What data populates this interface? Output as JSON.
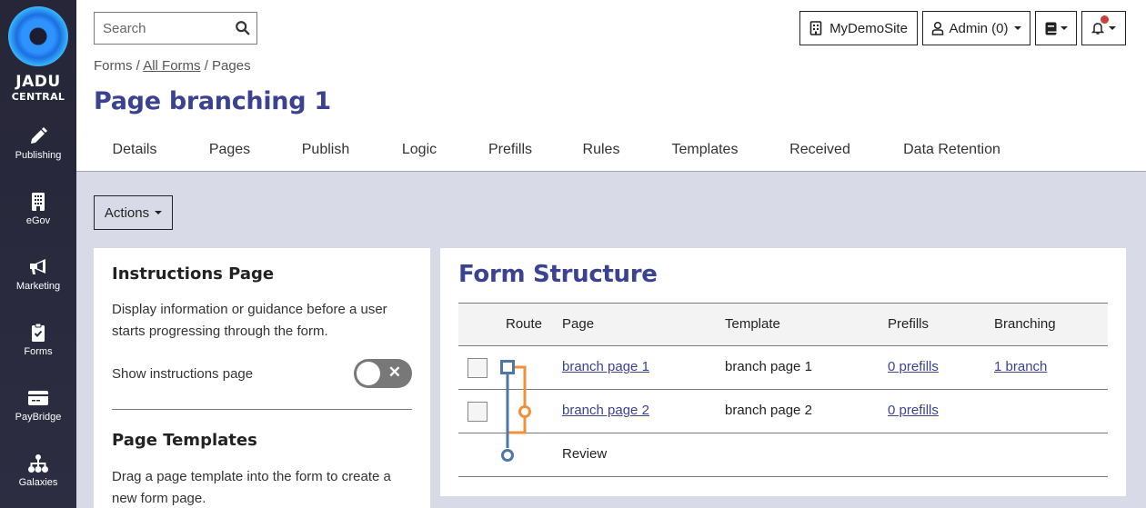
{
  "sidebar": {
    "logo": {
      "line1": "JADU",
      "line2": "CENTRAL"
    },
    "items": [
      {
        "label": "Publishing",
        "icon": "pencil-icon"
      },
      {
        "label": "eGov",
        "icon": "building-icon"
      },
      {
        "label": "Marketing",
        "icon": "megaphone-icon"
      },
      {
        "label": "Forms",
        "icon": "clipboard-check-icon"
      },
      {
        "label": "PayBridge",
        "icon": "credit-card-icon"
      },
      {
        "label": "Galaxies",
        "icon": "sitemap-icon"
      }
    ]
  },
  "header": {
    "search": {
      "placeholder": "Search",
      "value": ""
    },
    "site_button": "MyDemoSite",
    "user_button": "Admin (0)",
    "breadcrumb": [
      {
        "label": "Forms",
        "link": false
      },
      {
        "label": "All Forms",
        "link": true
      },
      {
        "label": "Pages",
        "link": false
      }
    ],
    "breadcrumb_separator": "/",
    "title": "Page branching 1",
    "tabs": [
      {
        "label": "Details",
        "active": false
      },
      {
        "label": "Pages",
        "active": true
      },
      {
        "label": "Publish",
        "active": false
      },
      {
        "label": "Logic",
        "active": false
      },
      {
        "label": "Prefills",
        "active": false
      },
      {
        "label": "Rules",
        "active": false
      },
      {
        "label": "Templates",
        "active": false
      },
      {
        "label": "Received",
        "active": false
      },
      {
        "label": "Data Retention",
        "active": false
      }
    ]
  },
  "actions_label": "Actions",
  "instructions": {
    "title": "Instructions Page",
    "description": "Display information or guidance before a user starts progressing through the form.",
    "toggle_label": "Show instructions page",
    "toggle_on": false,
    "toggle_off_glyph": "✕"
  },
  "templates": {
    "title": "Page Templates",
    "description": "Drag a page template into the form to create a new form page."
  },
  "form_structure": {
    "title": "Form Structure",
    "columns": [
      "Route",
      "Page",
      "Template",
      "Prefills",
      "Branching"
    ],
    "rows": [
      {
        "page": "branch page 1",
        "template": "branch page 1",
        "prefills": "0 prefills",
        "branching": "1 branch",
        "checkbox": true
      },
      {
        "page": "branch page 2",
        "template": "branch page 2",
        "prefills": "0 prefills",
        "branching": "",
        "checkbox": true
      },
      {
        "page": "Review",
        "template": "",
        "prefills": "",
        "branching": "",
        "checkbox": false
      }
    ],
    "route_colors": {
      "main": "#4e76a6",
      "branch": "#f0913a"
    }
  },
  "colors": {
    "brand": "#3b4390",
    "sidebar_bg": "#262638",
    "content_bg": "#d8dae7",
    "notification_dot": "#c9403a"
  }
}
